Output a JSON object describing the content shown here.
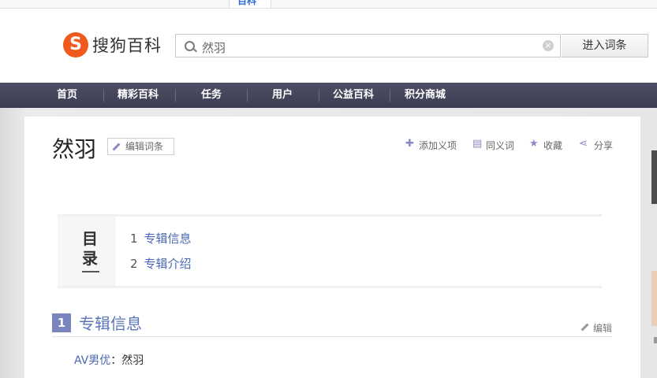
{
  "browser": {
    "active_tab": "百科"
  },
  "header": {
    "logo_text": "搜狗百科",
    "search_value": "然羽",
    "search_button": "进入词条",
    "clear_glyph": "×"
  },
  "nav": [
    "首页",
    "精彩百科",
    "任务",
    "用户",
    "公益百科",
    "积分商城"
  ],
  "entry": {
    "title": "然羽",
    "edit_label": "编辑词条",
    "actions": [
      {
        "label": "添加义项",
        "icon": "plus-icon"
      },
      {
        "label": "同义词",
        "icon": "synonym-icon"
      },
      {
        "label": "收藏",
        "icon": "star-icon"
      },
      {
        "label": "分享",
        "icon": "share-icon"
      }
    ]
  },
  "toc": {
    "label": "目录",
    "items": [
      {
        "num": "1",
        "text": "专辑信息"
      },
      {
        "num": "2",
        "text": "专辑介绍"
      }
    ]
  },
  "section": {
    "num": "1",
    "title": "专辑信息",
    "edit_label": "编辑",
    "rows": [
      {
        "key": "AV男优",
        "sep": "：",
        "value": "然羽"
      }
    ]
  },
  "colors": {
    "nav_bg": "#44445a",
    "link": "#4a68b5",
    "accent": "#7b85bd",
    "logo": "#f05a1e"
  }
}
